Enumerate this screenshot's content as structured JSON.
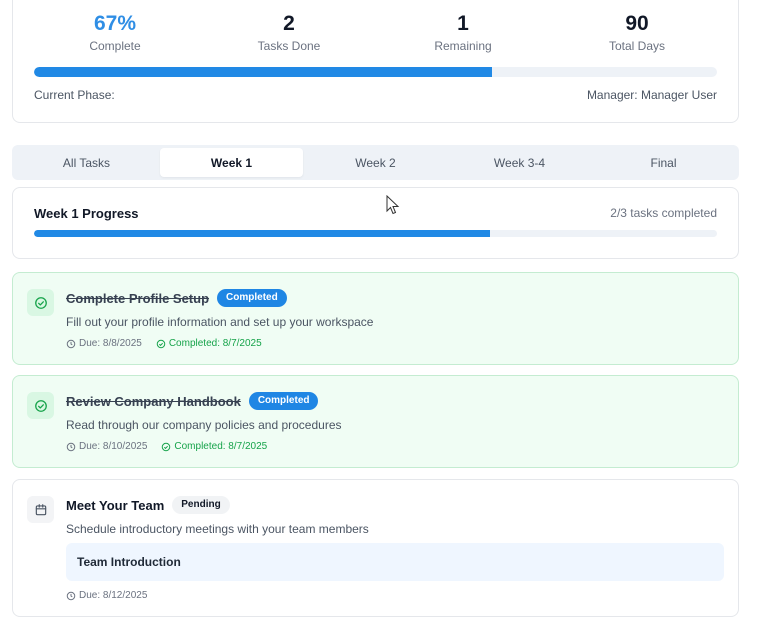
{
  "stats": {
    "percent": {
      "value": "67%",
      "label": "Complete"
    },
    "tasks_done": {
      "value": "2",
      "label": "Tasks Done"
    },
    "remaining": {
      "value": "1",
      "label": "Remaining"
    },
    "total_days": {
      "value": "90",
      "label": "Total Days"
    },
    "overall_progress_fraction": 0.67,
    "current_phase_label": "Current Phase:",
    "manager_label": "Manager: Manager User"
  },
  "tabs": [
    {
      "label": "All Tasks",
      "active": false
    },
    {
      "label": "Week 1",
      "active": true
    },
    {
      "label": "Week 2",
      "active": false
    },
    {
      "label": "Week 3-4",
      "active": false
    },
    {
      "label": "Final",
      "active": false
    }
  ],
  "week_progress": {
    "title": "Week 1 Progress",
    "count_text": "2/3 tasks completed",
    "fraction": 0.667
  },
  "tasks": [
    {
      "title": "Complete Profile Setup",
      "status": "Completed",
      "description": "Fill out your profile information and set up your workspace",
      "due": "Due: 8/8/2025",
      "completed": "Completed: 8/7/2025"
    },
    {
      "title": "Review Company Handbook",
      "status": "Completed",
      "description": "Read through our company policies and procedures",
      "due": "Due: 8/10/2025",
      "completed": "Completed: 8/7/2025"
    },
    {
      "title": "Meet Your Team",
      "status": "Pending",
      "description": "Schedule introductory meetings with your team members",
      "subitem": "Team Introduction",
      "due": "Due: 8/12/2025"
    }
  ],
  "colors": {
    "accent": "#2189e5",
    "success": "#16a34a",
    "success_bg": "#f0fdf4"
  },
  "icons": {
    "task_done": "check-circle-icon",
    "task_pending": "calendar-icon",
    "due": "clock-icon",
    "completed": "check-circle-icon"
  }
}
